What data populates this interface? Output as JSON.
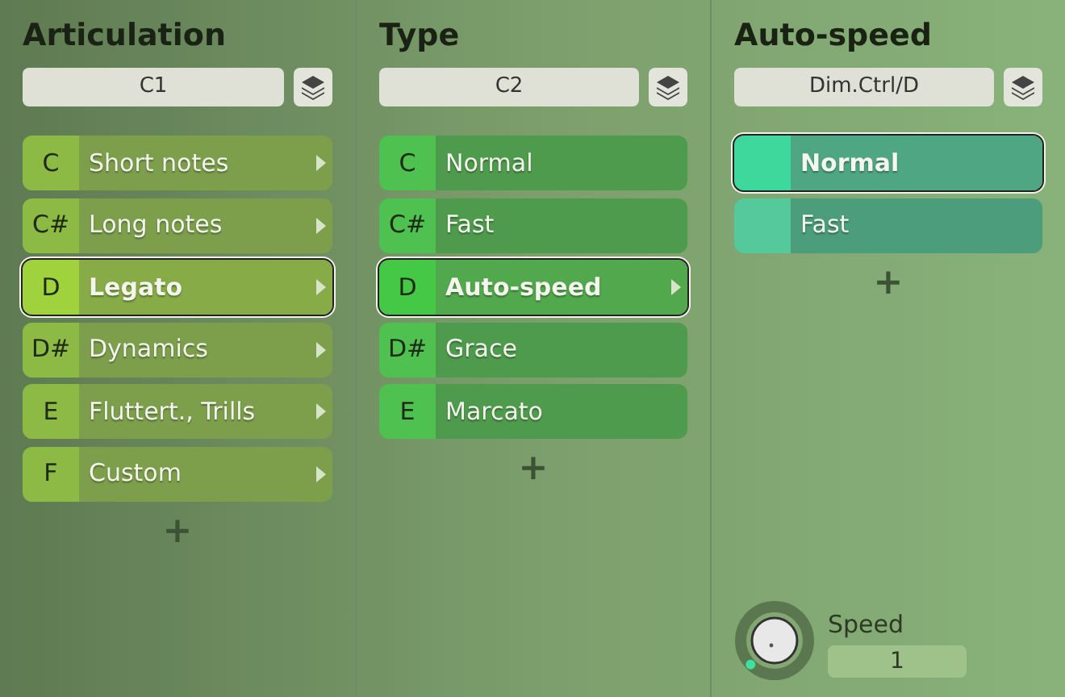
{
  "columns": [
    {
      "title": "Articulation",
      "kind": "lime",
      "field": "C1",
      "items": [
        {
          "key": "C",
          "label": "Short notes",
          "selected": false,
          "submenu": true
        },
        {
          "key": "C#",
          "label": "Long notes",
          "selected": false,
          "submenu": true
        },
        {
          "key": "D",
          "label": "Legato",
          "selected": true,
          "submenu": true
        },
        {
          "key": "D#",
          "label": "Dynamics",
          "selected": false,
          "submenu": true
        },
        {
          "key": "E",
          "label": "Fluttert., Trills",
          "selected": false,
          "submenu": true
        },
        {
          "key": "F",
          "label": "Custom",
          "selected": false,
          "submenu": true
        }
      ],
      "add": "+"
    },
    {
      "title": "Type",
      "kind": "green",
      "field": "C2",
      "items": [
        {
          "key": "C",
          "label": "Normal",
          "selected": false,
          "submenu": false
        },
        {
          "key": "C#",
          "label": "Fast",
          "selected": false,
          "submenu": false
        },
        {
          "key": "D",
          "label": "Auto-speed",
          "selected": true,
          "submenu": true
        },
        {
          "key": "D#",
          "label": "Grace",
          "selected": false,
          "submenu": false
        },
        {
          "key": "E",
          "label": "Marcato",
          "selected": false,
          "submenu": false
        }
      ],
      "add": "+"
    },
    {
      "title": "Auto-speed",
      "kind": "teal",
      "field": "Dim.Ctrl/D",
      "items": [
        {
          "label": "Normal",
          "selected": true,
          "submenu": false
        },
        {
          "label": "Fast",
          "selected": false,
          "submenu": false
        }
      ],
      "add": "+",
      "knob": {
        "label": "Speed",
        "value": "1"
      }
    }
  ]
}
